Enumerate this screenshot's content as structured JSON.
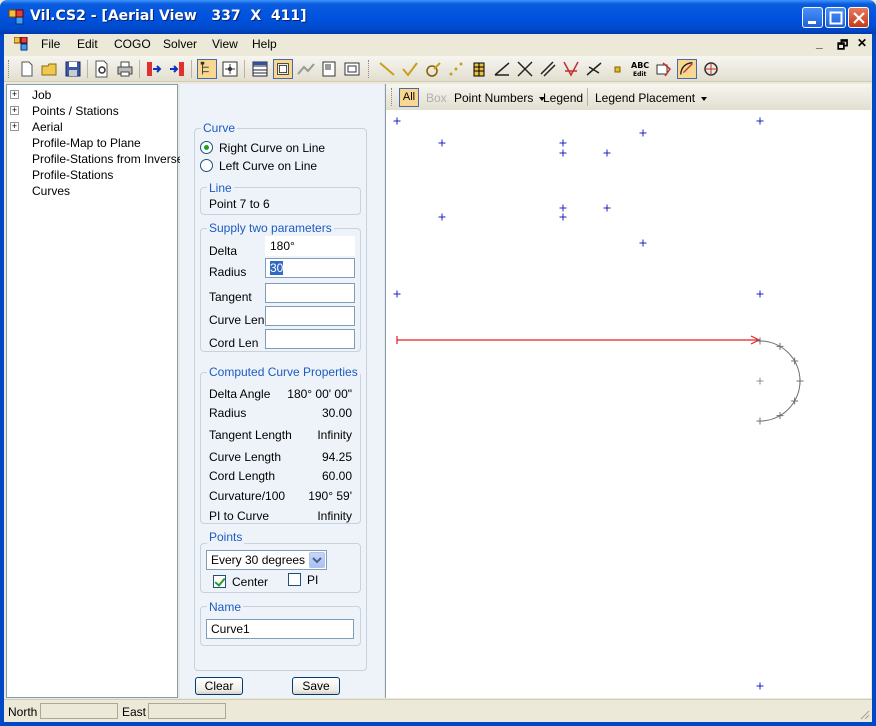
{
  "window": {
    "title": "Vil.CS2 - [Aerial View   337  X  411]"
  },
  "menu": {
    "items": [
      "File",
      "Edit",
      "COGO",
      "Solver",
      "View",
      "Help"
    ]
  },
  "tree": {
    "items": [
      {
        "label": "Job",
        "expandable": true
      },
      {
        "label": "Points / Stations",
        "expandable": true
      },
      {
        "label": "Aerial",
        "expandable": true
      },
      {
        "label": "Profile-Map to Plane",
        "expandable": false
      },
      {
        "label": "Profile-Stations from Inverse",
        "expandable": false
      },
      {
        "label": "Profile-Stations",
        "expandable": false
      },
      {
        "label": "Curves",
        "expandable": false
      }
    ]
  },
  "form": {
    "curve_group": "Curve",
    "radio_right": "Right Curve on Line",
    "radio_left": "Left Curve on Line",
    "radio_selected": "right",
    "line_group": "Line",
    "line_value": "Point 7 to 6",
    "params_group": "Supply two parameters",
    "delta_label": "Delta",
    "delta_value": "180°",
    "radius_label": "Radius",
    "radius_value": "30",
    "tangent_label": "Tangent",
    "tangent_value": "",
    "curvelen_label": "Curve Len",
    "curvelen_value": "",
    "cordlen_label": "Cord Len",
    "cordlen_value": "",
    "computed_group": "Computed Curve Properties",
    "computed": [
      {
        "label": "Delta Angle",
        "value": "180° 00' 00\""
      },
      {
        "label": "Radius",
        "value": "30.00"
      },
      {
        "label": "Tangent Length",
        "value": "Infinity"
      },
      {
        "label": "Curve Length",
        "value": "94.25"
      },
      {
        "label": "Cord Length",
        "value": "60.00"
      },
      {
        "label": "Curvature/100",
        "value": "190° 59'"
      },
      {
        "label": "PI to Curve",
        "value": "Infinity"
      }
    ],
    "points_group": "Points",
    "points_select": "Every 30 degrees",
    "center_label": "Center",
    "center_checked": true,
    "pi_label": "PI",
    "pi_checked": false,
    "name_group": "Name",
    "name_value": "Curve1",
    "clear_button": "Clear",
    "save_button": "Save"
  },
  "aerial_toolbar": {
    "all": "All",
    "box": "Box",
    "point_numbers": "Point Numbers",
    "legend": "Legend",
    "legend_placement": "Legend Placement"
  },
  "statusbar": {
    "north_label": "North",
    "north_value": "",
    "east_label": "East",
    "east_value": ""
  },
  "colors": {
    "points": "#2020C0",
    "line": "#E02020",
    "curve": "#707070"
  }
}
